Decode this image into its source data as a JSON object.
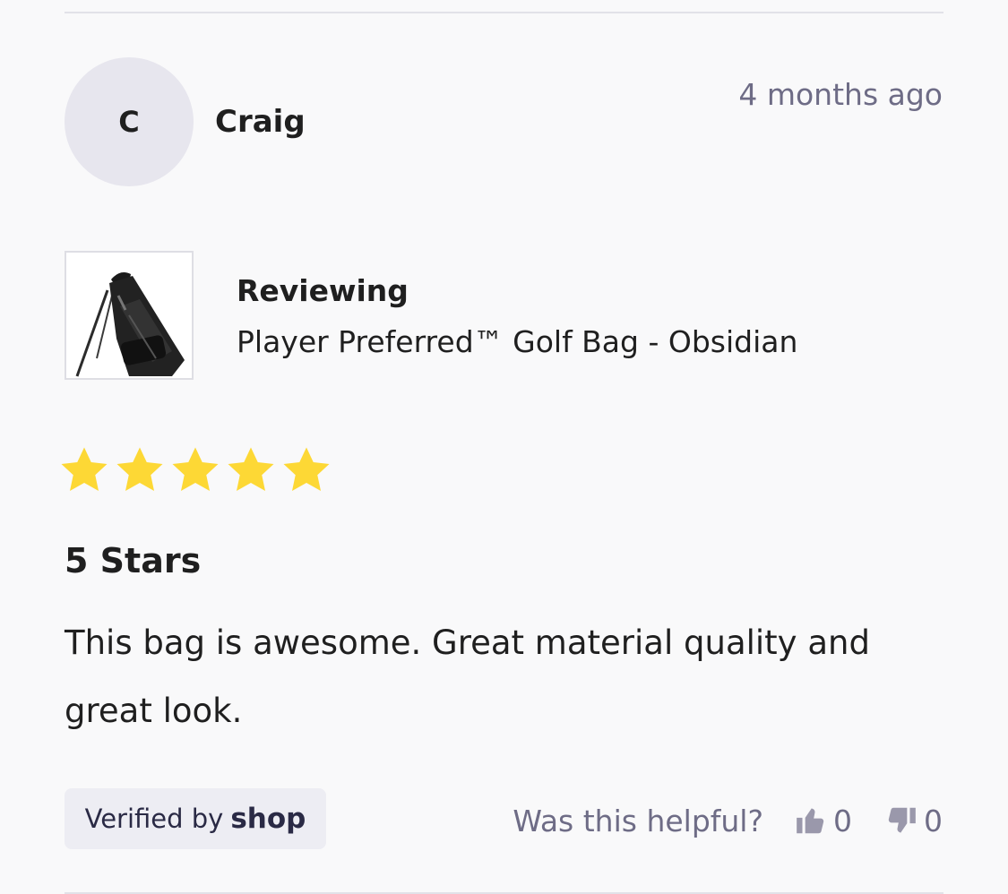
{
  "review": {
    "avatar_initial": "C",
    "author": "Craig",
    "timestamp": "4 months ago",
    "reviewing_label": "Reviewing",
    "product_name": "Player Preferred™ Golf Bag - Obsidian",
    "rating": 5,
    "rating_max": 5,
    "rating_title": "5 Stars",
    "body": "This bag is awesome. Great material quality and great look."
  },
  "footer": {
    "verified_prefix": "Verified by",
    "verified_brand": "shop",
    "helpful_prompt": "Was this helpful?",
    "upvotes": "0",
    "downvotes": "0"
  },
  "colors": {
    "star": "#fdd835",
    "muted_text": "#6e6c86",
    "avatar_bg": "#e7e6ee",
    "badge_bg": "#ededf3"
  },
  "icons": {
    "thumbs_up": "thumbs-up-icon",
    "thumbs_down": "thumbs-down-icon",
    "star": "star-icon"
  }
}
